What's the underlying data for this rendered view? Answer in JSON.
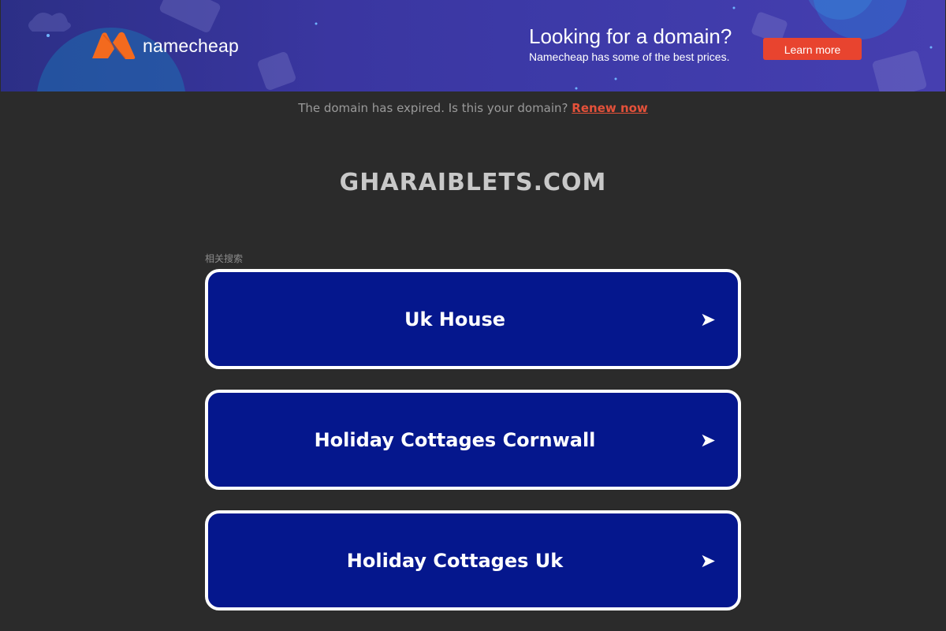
{
  "banner": {
    "brand": "namecheap",
    "headline": "Looking for a domain?",
    "subline": "Namecheap has some of the best prices.",
    "cta_label": "Learn more",
    "accent_color": "#e8442f"
  },
  "notice": {
    "text": "The domain has expired. Is this your domain?",
    "link_label": "Renew now"
  },
  "domain": {
    "title": "GHARAIBLETS.COM"
  },
  "related": {
    "label": "相关搜索",
    "items": [
      {
        "label": "Uk House",
        "icon": "arrow-right-icon"
      },
      {
        "label": "Holiday Cottages Cornwall",
        "icon": "arrow-right-icon"
      },
      {
        "label": "Holiday Cottages Uk",
        "icon": "arrow-right-icon"
      }
    ]
  },
  "colors": {
    "page_bg": "#2b2b2b",
    "card_bg": "#05178d",
    "card_border": "#ffffff",
    "link": "#e5513a"
  }
}
